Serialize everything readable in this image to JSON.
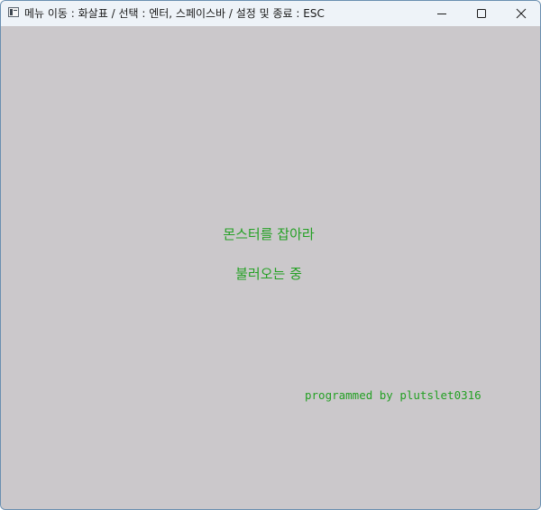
{
  "window": {
    "title": "메뉴 이동 : 화살표 / 선택 : 엔터, 스페이스바 / 설정 및 종료 : ESC",
    "controls": {
      "minimize_icon": "minimize-icon",
      "maximize_icon": "maximize-icon",
      "close_icon": "close-icon"
    }
  },
  "screen": {
    "game_title": "몬스터를 잡아라",
    "loading_text": "불러오는 중",
    "credit": "programmed by plutslet0316"
  },
  "colors": {
    "background": "#cbc8cb",
    "text_green": "#24a024",
    "titlebar": "#eef3f8"
  }
}
